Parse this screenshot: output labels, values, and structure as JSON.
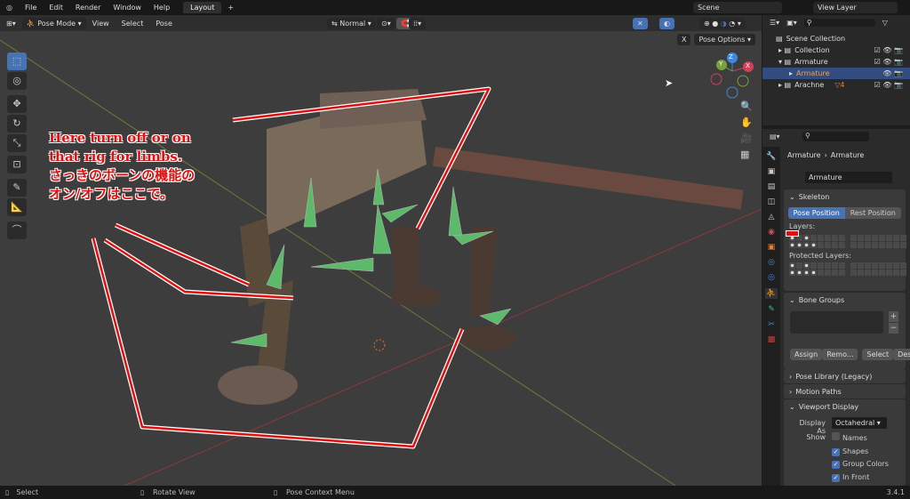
{
  "topbar": {
    "menus": [
      "File",
      "Edit",
      "Render",
      "Window",
      "Help"
    ],
    "workspace_tab": "Layout",
    "add_tab": "+",
    "scene": "Scene",
    "view_layer": "View Layer"
  },
  "viewport_header": {
    "mode": "Pose Mode",
    "menus": [
      "View",
      "Select",
      "Pose"
    ],
    "transform_orientation": "Normal",
    "pose_options": "Pose Options",
    "x_mirror": "X"
  },
  "gizmo": {
    "z": "Z",
    "y": "Y",
    "x": "X"
  },
  "annotation": {
    "lines": [
      "Here turn off or on",
      "that rig for limbs.",
      "さっきのボーンの機能の",
      "オン/オフはここで。"
    ],
    "color": "#e01010"
  },
  "outliner": {
    "rows": [
      {
        "label": "Scene Collection"
      },
      {
        "label": "Collection"
      },
      {
        "label": "Armature"
      },
      {
        "label": "Armature",
        "selected": true
      },
      {
        "label": "Arachne",
        "badge": "4"
      }
    ]
  },
  "properties": {
    "breadcrumb": [
      "Armature",
      "Armature"
    ],
    "data_name": "Armature",
    "skeleton": {
      "title": "Skeleton",
      "pose_position": "Pose Position",
      "rest_position": "Rest Position",
      "layers": "Layers:",
      "protected_layers": "Protected Layers:"
    },
    "bone_groups": {
      "title": "Bone Groups",
      "assign": "Assign",
      "remove": "Remo...",
      "select": "Select",
      "deselect": "Desel..."
    },
    "pose_library": "Pose Library (Legacy)",
    "motion_paths": "Motion Paths",
    "viewport_display": {
      "title": "Viewport Display",
      "display_as_label": "Display As",
      "display_as": "Octahedral",
      "show_label": "Show",
      "options": [
        {
          "label": "Names",
          "checked": false
        },
        {
          "label": "Shapes",
          "checked": true
        },
        {
          "label": "Group Colors",
          "checked": true
        },
        {
          "label": "In Front",
          "checked": true
        }
      ]
    }
  },
  "status": {
    "select": "Select",
    "rotate": "Rotate View",
    "context": "Pose Context Menu",
    "version": "3.4.1"
  },
  "colors": {
    "accent": "#4772b3",
    "selected_text": "#f0a050"
  }
}
